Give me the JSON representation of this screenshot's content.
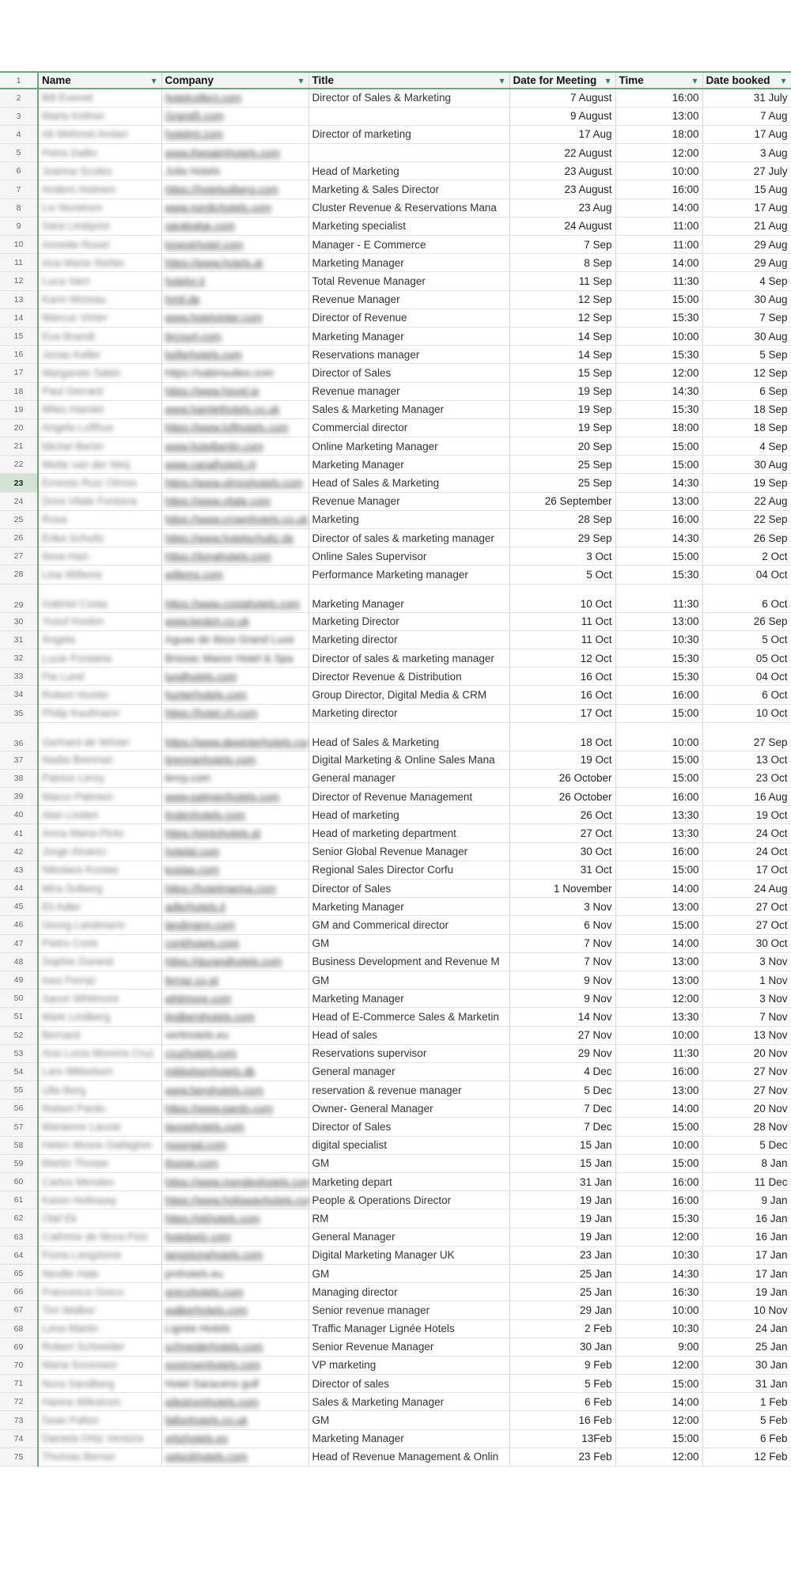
{
  "headers": [
    {
      "label": "Name"
    },
    {
      "label": "Company"
    },
    {
      "label": "Title"
    },
    {
      "label": "Date for Meeting"
    },
    {
      "label": "Time"
    },
    {
      "label": "Date booked"
    }
  ],
  "rows": [
    {
      "n": "2",
      "name": "Bill Everett",
      "company": "hotelcollect.com",
      "cstyle": "link",
      "title": "Director of Sales & Marketing",
      "date": "7 August",
      "time": "16:00",
      "booked": "31 July"
    },
    {
      "n": "3",
      "name": "Maria Kellner",
      "company": "Grand5.com",
      "cstyle": "link",
      "title": "",
      "date": "9 August",
      "time": "13:00",
      "booked": "7 Aug"
    },
    {
      "n": "4",
      "name": "Ali Mehmet Arslan",
      "company": "hotelmt.com",
      "cstyle": "link",
      "title": "Director of marketing",
      "date": "17 Aug",
      "time": "18:00",
      "booked": "17 Aug"
    },
    {
      "n": "5",
      "name": "Petra Dallin",
      "company": "www.thepalmhotels.com",
      "cstyle": "link",
      "title": "",
      "date": "22 August",
      "time": "12:00",
      "booked": "3 Aug"
    },
    {
      "n": "6",
      "name": "Joanna Scoles",
      "company": "Julia Hotels",
      "cstyle": "plain",
      "title": "Head of Marketing",
      "date": "23 August",
      "time": "10:00",
      "booked": "27 July"
    },
    {
      "n": "7",
      "name": "Anders Holmen",
      "company": "https://hotelsolberg.com",
      "cstyle": "link",
      "title": " Marketing & Sales Director",
      "date": "23 August",
      "time": "16:00",
      "booked": "15 Aug"
    },
    {
      "n": "8",
      "name": "Liv Norstrom",
      "company": "www.nordichotels.com",
      "cstyle": "link",
      "title": "Cluster Revenue & Reservations Mana",
      "date": "23 Aug",
      "time": "14:00",
      "booked": "17 Aug"
    },
    {
      "n": "9",
      "name": "Sara Lindqvist",
      "company": "saralodge.com",
      "cstyle": "link",
      "title": "Marketing specialist",
      "date": "24 August",
      "time": "11:00",
      "booked": "21 Aug"
    },
    {
      "n": "10",
      "name": "Annette Rovel",
      "company": "lonestrhotel.com",
      "cstyle": "link",
      "title": "Manager - E Commerce",
      "date": "7 Sep",
      "time": "11:00",
      "booked": "29 Aug"
    },
    {
      "n": "11",
      "name": "Ana Maria Stefan",
      "company": "https://www.hotels.at",
      "cstyle": "link",
      "title": "Marketing Manager",
      "date": "8 Sep",
      "time": "14:00",
      "booked": "29 Aug"
    },
    {
      "n": "12",
      "name": "Luca Varri",
      "company": "hotelvr.it",
      "cstyle": "link",
      "title": "Total Revenue Manager",
      "date": "11 Sep",
      "time": "11:30",
      "booked": "4 Sep"
    },
    {
      "n": "13",
      "name": "Karin Moreau",
      "company": "hmtl.de",
      "cstyle": "link",
      "title": "Revenue Manager",
      "date": "12 Sep",
      "time": "15:00",
      "booked": "30 Aug"
    },
    {
      "n": "14",
      "name": "Marcus Vinter",
      "company": "www.hotelvinter.com",
      "cstyle": "link",
      "title": "Director of Revenue",
      "date": "12 Sep",
      "time": "15:30",
      "booked": "7 Sep"
    },
    {
      "n": "15",
      "name": "Eva Brandt",
      "company": "brcourt.com",
      "cstyle": "link",
      "title": "Marketing Manager",
      "date": "14 Sep",
      "time": "10:00",
      "booked": "30 Aug"
    },
    {
      "n": "16",
      "name": "Jonas Keller",
      "company": "kellerhotels.com",
      "cstyle": "link",
      "title": "Reservations manager",
      "date": "14 Sep",
      "time": "15:30",
      "booked": "5 Sep"
    },
    {
      "n": "17",
      "name": "Margarete Sabin",
      "company": "https://sabinsuites.com",
      "cstyle": "plain",
      "title": "Director of Sales",
      "date": "15 Sep",
      "time": "12:00",
      "booked": "12 Sep"
    },
    {
      "n": "18",
      "name": "Paul Gerrard",
      "company": "https://www.hovel.ie",
      "cstyle": "link",
      "title": "Revenue manager",
      "date": "19 Sep",
      "time": "14:30",
      "booked": "6 Sep"
    },
    {
      "n": "19",
      "name": "Miles Hamlet",
      "company": "www.hamlethotels.co.uk",
      "cstyle": "link",
      "title": "Sales & Marketing Manager",
      "date": "19 Sep",
      "time": "15:30",
      "booked": "18 Sep"
    },
    {
      "n": "20",
      "name": "Angela Lofthus",
      "company": "https://www.lofthotels.com",
      "cstyle": "link",
      "title": "Commercial director",
      "date": "19 Sep",
      "time": "18:00",
      "booked": "18 Sep"
    },
    {
      "n": "21",
      "name": "Michel Bertin",
      "company": "www.hotelbertin.com",
      "cstyle": "link",
      "title": "Online Marketing Manager",
      "date": "20 Sep",
      "time": "15:00",
      "booked": "4 Sep"
    },
    {
      "n": "22",
      "name": "Mette van der Meij",
      "company": "www.canalhotels.nl",
      "cstyle": "link",
      "title": "Marketing Manager",
      "date": "25 Sep",
      "time": "15:00",
      "booked": "30 Aug"
    },
    {
      "n": "23",
      "name": "Ernesto Ruiz Olmos",
      "company": "https://www.olmoshotels.com",
      "cstyle": "link",
      "title": "Head of Sales & Marketing",
      "date": "25 Sep",
      "time": "14:30",
      "booked": "19 Sep",
      "sel": true
    },
    {
      "n": "24",
      "name": "Dora Vitale Fontana",
      "company": "https://www.vitale.com",
      "cstyle": "link",
      "title": "Revenue Manager",
      "date": "26 September",
      "time": "13:00",
      "booked": "22 Aug"
    },
    {
      "n": "25",
      "name": "Rosa",
      "company": "https://www.crownhotels.co.uk",
      "cstyle": "link",
      "title": "Marketing",
      "date": "28 Sep",
      "time": "16:00",
      "booked": "22 Sep"
    },
    {
      "n": "26",
      "name": "Erika Schultz",
      "company": "https://www.hotelschultz.de",
      "cstyle": "link",
      "title": "Director of sales & marketing manager",
      "date": "29 Sep",
      "time": "14:30",
      "booked": "26 Sep"
    },
    {
      "n": "27",
      "name": "Ilona Hart",
      "company": "https://ilonahotels.com",
      "cstyle": "link",
      "title": "Online Sales Supervisor",
      "date": "3 Oct",
      "time": "15:00",
      "booked": "2 Oct"
    },
    {
      "n": "28",
      "name": "Lina Willems",
      "company": "willems.com",
      "cstyle": "link",
      "title": "Performance Marketing manager",
      "date": "5 Oct",
      "time": "15:30",
      "booked": "04 Oct"
    },
    {
      "n": "29",
      "name": "Gabriel Costa",
      "company": "https://www.costahotels.com",
      "cstyle": "link",
      "title": "Marketing Manager",
      "date": "10 Oct",
      "time": "11:30",
      "booked": "6 Oct",
      "tall": true
    },
    {
      "n": "30",
      "name": "Yusuf Keskin",
      "company": "www.keskin.co.uk",
      "cstyle": "link",
      "title": "Marketing Director",
      "date": "11 Oct",
      "time": "13:00",
      "booked": "26 Sep"
    },
    {
      "n": "31",
      "name": "Ángela",
      "company": "Aguas de Ibiza Grand Luxe",
      "cstyle": "plain",
      "title": "Marketing director",
      "date": "11 Oct",
      "time": "10:30",
      "booked": "5 Oct"
    },
    {
      "n": "32",
      "name": "Lucie Fontaine",
      "company": "Brissac Manor Hotel & Spa",
      "cstyle": "plain",
      "title": "Director of sales & marketing manager",
      "date": "12 Oct",
      "time": "15:30",
      "booked": "05 Oct"
    },
    {
      "n": "33",
      "name": "Pia Lund",
      "company": "lundhotels.com",
      "cstyle": "link",
      "title": "Director Revenue & Distribution",
      "date": "16 Oct",
      "time": "15:30",
      "booked": "04 Oct"
    },
    {
      "n": "34",
      "name": "Robert Hunter",
      "company": "hunterhotels.com",
      "cstyle": "link",
      "title": "Group Director, Digital Media & CRM",
      "date": "16 Oct",
      "time": "16:00",
      "booked": "6 Oct"
    },
    {
      "n": "35",
      "name": "Philip Kaufmann",
      "company": "https://hotel.ch.com",
      "cstyle": "link",
      "title": "Marketing director",
      "date": "17 Oct",
      "time": "15:00",
      "booked": "10 Oct"
    },
    {
      "n": "36",
      "name": "Gerhard de Winter",
      "company": "https://www.dewinterhotels.com",
      "cstyle": "link",
      "title": "Head of Sales & Marketing",
      "date": "18 Oct",
      "time": "10:00",
      "booked": "27 Sep",
      "tall": true
    },
    {
      "n": "37",
      "name": "Nadia Brennan",
      "company": "brennanhotels.com",
      "cstyle": "link",
      "title": "Digital Marketing & Online Sales Mana",
      "date": "19 Oct",
      "time": "15:00",
      "booked": "13 Oct"
    },
    {
      "n": "38",
      "name": "Patrice Leroy",
      "company": "leroy.com",
      "cstyle": "plain",
      "title": "General manager",
      "date": "26 October",
      "time": "15:00",
      "booked": "23 Oct"
    },
    {
      "n": "39",
      "name": "Marco Palmieri",
      "company": "www.palmierihotels.com",
      "cstyle": "link",
      "title": "Director of Revenue Management",
      "date": "26 October",
      "time": "16:00",
      "booked": "16 Aug"
    },
    {
      "n": "40",
      "name": "Alan Linden",
      "company": "lindenhotels.com",
      "cstyle": "link",
      "title": "Head of marketing",
      "date": "26 Oct",
      "time": "13:30",
      "booked": "19 Oct"
    },
    {
      "n": "41",
      "name": "Anna Maria Pinto",
      "company": "https://pintohotels.pt",
      "cstyle": "link",
      "title": "Head of marketing department",
      "date": "27 Oct",
      "time": "13:30",
      "booked": "24 Oct"
    },
    {
      "n": "42",
      "name": "Jorge Alvarez",
      "company": "hotelal.com",
      "cstyle": "link",
      "title": "Senior Global Revenue Manager",
      "date": "30 Oct",
      "time": "16:00",
      "booked": "24 Oct"
    },
    {
      "n": "43",
      "name": "Nikolaos Kostas",
      "company": "kostas.com",
      "cstyle": "link",
      "title": "Regional Sales Director Corfu",
      "date": "31 Oct",
      "time": "15:00",
      "booked": "17 Oct"
    },
    {
      "n": "44",
      "name": "Mira Solberg",
      "company": "https://hotelmarina.com",
      "cstyle": "link",
      "title": "Director of Sales",
      "date": "1 November",
      "time": "14:00",
      "booked": "24 Aug"
    },
    {
      "n": "45",
      "name": "Eli Adler",
      "company": "adlerhotels.it",
      "cstyle": "link",
      "title": "Marketing Manager",
      "date": "3 Nov",
      "time": "13:00",
      "booked": "27 Oct"
    },
    {
      "n": "46",
      "name": "Georg Landmann",
      "company": "landmann.com",
      "cstyle": "link",
      "title": "GM and Commerical director",
      "date": "6 Nov",
      "time": "15:00",
      "booked": "27 Oct"
    },
    {
      "n": "47",
      "name": "Pietro Conti",
      "company": "contihotels.com",
      "cstyle": "link",
      "title": "GM",
      "date": "7 Nov",
      "time": "14:00",
      "booked": "30 Oct"
    },
    {
      "n": "48",
      "name": "Sophie Durand",
      "company": "https://durandhotels.com",
      "cstyle": "link",
      "title": "Business Development and Revenue M",
      "date": "7 Nov",
      "time": "13:00",
      "booked": "3 Nov"
    },
    {
      "n": "49",
      "name": "Ines Ferraz",
      "company": "ferraz.co.pt",
      "cstyle": "link",
      "title": "GM",
      "date": "9 Nov",
      "time": "13:00",
      "booked": "1 Nov"
    },
    {
      "n": "50",
      "name": "Aaron Whitmore",
      "company": "whitmore.com",
      "cstyle": "link",
      "title": "Marketing Manager",
      "date": "9 Nov",
      "time": "12:00",
      "booked": "3 Nov"
    },
    {
      "n": "51",
      "name": "Mark Lindberg",
      "company": "lindberghotels.com",
      "cstyle": "link",
      "title": "Head of E-Commerce Sales & Marketin",
      "date": "14 Nov",
      "time": "13:30",
      "booked": "7 Nov"
    },
    {
      "n": "52",
      "name": "Bernard",
      "company": "vertinotels.eu",
      "cstyle": "plain",
      "title": "Head of sales",
      "date": "27 Nov",
      "time": "10:00",
      "booked": "13 Nov"
    },
    {
      "n": "53",
      "name": "Ana Lucia Moreira Cruz",
      "company": "cruzhotels.com",
      "cstyle": "link",
      "title": "Reservations supervisor",
      "date": "29 Nov",
      "time": "11:30",
      "booked": "20 Nov"
    },
    {
      "n": "54",
      "name": "Lars Mikkelsen",
      "company": "mikkelsenhotels.dk",
      "cstyle": "link",
      "title": "General manager",
      "date": "4 Dec",
      "time": "16:00",
      "booked": "27 Nov"
    },
    {
      "n": "55",
      "name": "Ulla Berg",
      "company": "www.berghotels.com",
      "cstyle": "link",
      "title": "reservation & revenue manager",
      "date": "5 Dec",
      "time": "13:00",
      "booked": "27 Nov"
    },
    {
      "n": "56",
      "name": "Robert Pardo",
      "company": "https://www.pardo.com",
      "cstyle": "link",
      "title": "Owner- General Manager",
      "date": "7 Dec",
      "time": "14:00",
      "booked": "20 Nov"
    },
    {
      "n": "57",
      "name": "Marianne Lavoie",
      "company": "lavoiehotels.com",
      "cstyle": "link",
      "title": "Director of Sales",
      "date": "7 Dec",
      "time": "15:00",
      "booked": "28 Nov"
    },
    {
      "n": "58",
      "name": "Helen Moore Gallagher",
      "company": "moorgal.com",
      "cstyle": "link",
      "title": "digital specialist",
      "date": "15 Jan",
      "time": "10:00",
      "booked": "5 Dec"
    },
    {
      "n": "59",
      "name": "Martin Thorpe",
      "company": "thorpe.com",
      "cstyle": "link",
      "title": "GM",
      "date": "15 Jan",
      "time": "15:00",
      "booked": "8 Jan"
    },
    {
      "n": "60",
      "name": "Carlos Mendes",
      "company": "https://www.mendeshotels.com",
      "cstyle": "link",
      "title": "Marketing depart",
      "date": "31 Jan",
      "time": "16:00",
      "booked": "11 Dec"
    },
    {
      "n": "61",
      "name": "Karen Holloway",
      "company": "https://www.hollowayhotels.com",
      "cstyle": "link",
      "title": "People & Operations Director",
      "date": "19 Jan",
      "time": "16:00",
      "booked": "9 Jan"
    },
    {
      "n": "62",
      "name": "Olaf Ek",
      "company": "https://ekhotels.com",
      "cstyle": "link",
      "title": "RM",
      "date": "19 Jan",
      "time": "15:30",
      "booked": "16 Jan"
    },
    {
      "n": "63",
      "name": "Cathrine de Mora Pelz",
      "company": "hotelpelz.com",
      "cstyle": "link",
      "title": "General Manager",
      "date": "19 Jan",
      "time": "12:00",
      "booked": "16 Jan"
    },
    {
      "n": "64",
      "name": "Fiona Langstone",
      "company": "langstonehotels.com",
      "cstyle": "link",
      "title": "Digital Marketing Manager UK",
      "date": "23 Jan",
      "time": "10:30",
      "booked": "17 Jan"
    },
    {
      "n": "65",
      "name": "Neville Hale",
      "company": "pmhotels.eu",
      "cstyle": "plain",
      "title": "GM",
      "date": "25 Jan",
      "time": "14:30",
      "booked": "17 Jan"
    },
    {
      "n": "66",
      "name": "Francesca Greco",
      "company": "grecohotels.com",
      "cstyle": "link",
      "title": "Managing director",
      "date": "25 Jan",
      "time": "16:30",
      "booked": "19 Jan"
    },
    {
      "n": "67",
      "name": "Tim Walker",
      "company": "walkerhotels.com",
      "cstyle": "link",
      "title": "Senior revenue manager",
      "date": "29 Jan",
      "time": "10:00",
      "booked": "10 Nov"
    },
    {
      "n": "68",
      "name": "Lena Martin",
      "company": "Lignée Hotels",
      "cstyle": "plain",
      "title": "Traffic Manager Lignée Hotels",
      "date": "2 Feb",
      "time": "10:30",
      "booked": "24 Jan"
    },
    {
      "n": "69",
      "name": "Robert Schneider",
      "company": "schneiderhotels.com",
      "cstyle": "link",
      "title": "Senior Revenue Manager",
      "date": "30 Jan",
      "time": "9:00",
      "booked": "25 Jan"
    },
    {
      "n": "70",
      "name": "Maria Sorensen",
      "company": "sorensenhotels.com",
      "cstyle": "link",
      "title": "VP marketing",
      "date": "9 Feb",
      "time": "12:00",
      "booked": "30 Jan"
    },
    {
      "n": "71",
      "name": "Nora Sandberg",
      "company": "Hotel Saraceno golf",
      "cstyle": "plain",
      "title": "Director of sales",
      "date": "5 Feb",
      "time": "15:00",
      "booked": "31 Jan"
    },
    {
      "n": "72",
      "name": "Hanna Wikstrom",
      "company": "wikstromhotels.com",
      "cstyle": "link",
      "title": "Sales & Marketing Manager",
      "date": "6 Feb",
      "time": "14:00",
      "booked": "1 Feb"
    },
    {
      "n": "73",
      "name": "Sean Fallon",
      "company": "fallonhotels.co.uk",
      "cstyle": "link",
      "title": "GM",
      "date": "16 Feb",
      "time": "12:00",
      "booked": "5 Feb"
    },
    {
      "n": "74",
      "name": "Daniela Ortiz Ventura",
      "company": "ortizhotels.es",
      "cstyle": "link",
      "title": "Marketing Manager",
      "date": "13Feb",
      "time": "15:00",
      "booked": "6 Feb"
    },
    {
      "n": "75",
      "name": "Thomas Berner",
      "company": "uplockhotels.com",
      "cstyle": "link",
      "title": "Head of Revenue Management & Onlin",
      "date": "23 Feb",
      "time": "12:00",
      "booked": "12 Feb"
    }
  ],
  "colors": {
    "accent": "#6aa874",
    "link": "#1a4fd6",
    "header_bg": "#f3f3f3"
  }
}
